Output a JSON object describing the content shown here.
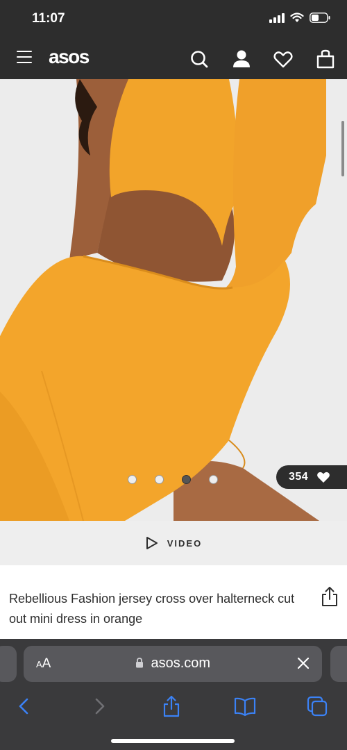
{
  "status_bar": {
    "time": "11:07"
  },
  "header": {
    "logo": "asos",
    "icons": [
      "menu-icon",
      "search-icon",
      "account-icon",
      "heart-icon",
      "bag-icon"
    ]
  },
  "gallery": {
    "image_count": 4,
    "active_index": 2,
    "likes_count": "354"
  },
  "video": {
    "label": "VIDEO"
  },
  "product": {
    "title": "Rebellious Fashion jersey cross over halterneck cut out mini dress in orange"
  },
  "browser": {
    "text_size_label": "AA",
    "url": "asos.com",
    "nav_icons": [
      "back-icon",
      "forward-icon",
      "share-icon",
      "bookmarks-icon",
      "tabs-icon"
    ]
  },
  "colors": {
    "dark_bg": "#2d2d2d",
    "dress_orange": "#f2a42a",
    "accent_blue": "#3b82f6"
  }
}
